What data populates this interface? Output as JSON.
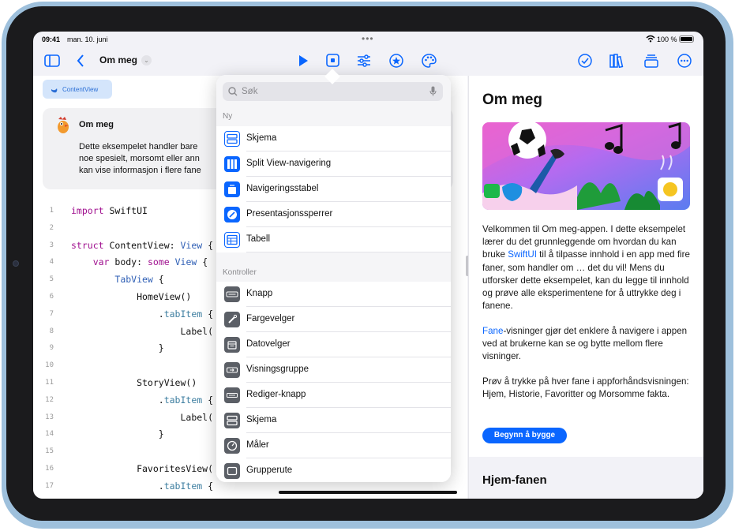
{
  "status": {
    "time": "09:41",
    "date": "man. 10. juni",
    "battery": "100 %",
    "battery_level": 1.0
  },
  "toolbar": {
    "title": "Om meg",
    "icons": [
      "sidebar-icon",
      "back-chevron-icon",
      "play-icon",
      "preview-icon",
      "settings-sliders-icon",
      "star-icon",
      "palette-icon",
      "checkmark-circle-icon",
      "library-icon",
      "stack-icon",
      "more-icon"
    ]
  },
  "chip": {
    "label": "ContentView"
  },
  "note": {
    "title": "Om meg",
    "text_lines": [
      "Dette eksempelet handler bare",
      "noe spesielt, morsomt eller ann",
      "kan vise informasjon i flere fane"
    ]
  },
  "code": [
    {
      "n": "1",
      "text": "import SwiftUI"
    },
    {
      "n": "2",
      "text": ""
    },
    {
      "n": "3",
      "text": "struct ContentView: View {"
    },
    {
      "n": "4",
      "text": "    var body: some View {"
    },
    {
      "n": "5",
      "text": "        TabView {"
    },
    {
      "n": "6",
      "text": "            HomeView()"
    },
    {
      "n": "7",
      "text": "                .tabItem {"
    },
    {
      "n": "8",
      "text": "                    Label("
    },
    {
      "n": "9",
      "text": "                }"
    },
    {
      "n": "10",
      "text": ""
    },
    {
      "n": "11",
      "text": "            StoryView()"
    },
    {
      "n": "12",
      "text": "                .tabItem {"
    },
    {
      "n": "13",
      "text": "                    Label("
    },
    {
      "n": "14",
      "text": "                }"
    },
    {
      "n": "15",
      "text": ""
    },
    {
      "n": "16",
      "text": "            FavoritesView("
    },
    {
      "n": "17",
      "text": "                .tabItem {"
    }
  ],
  "popover": {
    "search_placeholder": "Søk",
    "section_new": "Ny",
    "new_items": [
      "Skjema",
      "Split View-navigering",
      "Navigeringsstabel",
      "Presentasjonssperrer",
      "Tabell"
    ],
    "section_controls": "Kontroller",
    "control_items": [
      "Knapp",
      "Fargevelger",
      "Datovelger",
      "Visningsgruppe",
      "Rediger-knapp",
      "Skjema",
      "Måler",
      "Grupperute"
    ]
  },
  "preview": {
    "title": "Om meg",
    "p1_a": "Velkommen til Om meg-appen. I dette eksempelet lærer du det grunnleggende om hvordan du kan bruke ",
    "p1_link": "SwiftUI",
    "p1_b": " til å tilpasse innhold i en app med fire faner, som handler om … det du vil! Mens du utforsker dette eksempelet, kan du legge til innhold og prøve alle eksperimentene for å uttrykke deg i fanene.",
    "p2_link": "Fane",
    "p2_b": "-visninger gjør det enklere å navigere i appen ved at brukerne kan se og bytte mellom flere visninger.",
    "p3": "Prøv å trykke på hver fane i appforhåndsvisningen: Hjem, Historie, Favoritter og Morsomme fakta.",
    "button": "Begynn å bygge",
    "section": "Hjem-fanen"
  },
  "colors": {
    "accent": "#0a66ff",
    "frame": "#9ec0dc"
  }
}
